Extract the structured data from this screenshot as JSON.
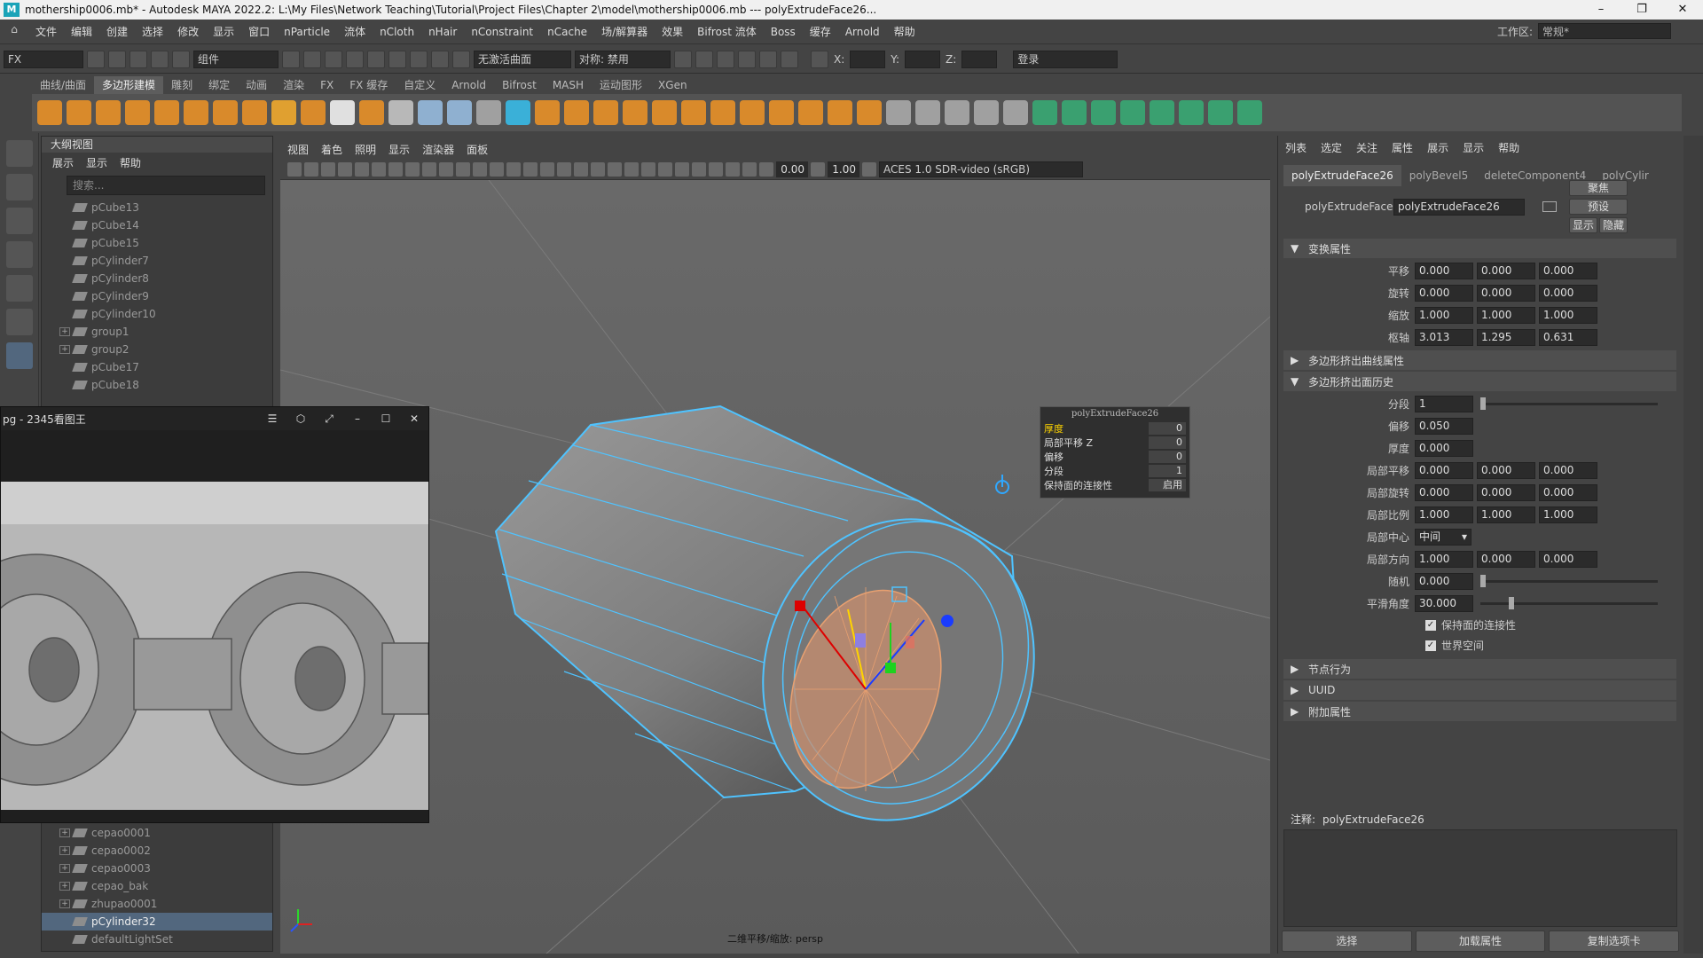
{
  "titlebar": {
    "title": "mothership0006.mb* - Autodesk MAYA 2022.2: L:\\My Files\\Network Teaching\\Tutorial\\Project Files\\Chapter 2\\model\\mothership0006.mb   ---   polyExtrudeFace26...",
    "minimize": "–",
    "restore": "❐",
    "close": "✕"
  },
  "menubar": {
    "items": [
      "文件",
      "编辑",
      "创建",
      "选择",
      "修改",
      "显示",
      "窗口",
      "nParticle",
      "流体",
      "nCloth",
      "nHair",
      "nConstraint",
      "nCache",
      "场/解算器",
      "效果",
      "Bifrost 流体",
      "Boss",
      "缓存",
      "Arnold",
      "帮助"
    ],
    "workspace_label": "工作区:",
    "workspace_value": "常规*"
  },
  "statusline": {
    "mode": "FX",
    "component_field": "组件",
    "live_surface": "无激活曲面",
    "symmetry": "对称: 禁用",
    "x_label": "X:",
    "y_label": "Y:",
    "z_label": "Z:",
    "login": "登录"
  },
  "shelf": {
    "tabs": [
      "曲线/曲面",
      "多边形建模",
      "雕刻",
      "绑定",
      "动画",
      "渲染",
      "FX",
      "FX 缓存",
      "自定义",
      "Arnold",
      "Bifrost",
      "MASH",
      "运动图形",
      "XGen"
    ],
    "active_tab": "多边形建模",
    "icon_colors": [
      "#d98a2b",
      "#d98a2b",
      "#d98a2b",
      "#d98a2b",
      "#d98a2b",
      "#d98a2b",
      "#d98a2b",
      "#d98a2b",
      "#e0a030",
      "#d98a2b",
      "#e0e0e0",
      "#d98a2b",
      "#b8b8b8",
      "#8fb0d0",
      "#8fb0d0",
      "#a0a0a0",
      "#3ab0d8",
      "#d98a2b",
      "#d98a2b",
      "#d98a2b",
      "#d98a2b",
      "#d98a2b",
      "#d98a2b",
      "#d98a2b",
      "#d98a2b",
      "#d98a2b",
      "#d98a2b",
      "#d98a2b",
      "#d98a2b",
      "#a0a0a0",
      "#a0a0a0",
      "#a0a0a0",
      "#a0a0a0",
      "#a0a0a0",
      "#3aa070",
      "#3aa070",
      "#3aa070",
      "#3aa070",
      "#3aa070",
      "#3aa070",
      "#3aa070",
      "#3aa070"
    ]
  },
  "outliner": {
    "title": "大纲视图",
    "menus": [
      "展示",
      "显示",
      "帮助"
    ],
    "search_placeholder": "搜索...",
    "items_top": [
      {
        "label": "pCube13",
        "expandable": false,
        "selected": false
      },
      {
        "label": "pCube14",
        "expandable": false,
        "selected": false
      },
      {
        "label": "pCube15",
        "expandable": false,
        "selected": false
      },
      {
        "label": "pCylinder7",
        "expandable": false,
        "selected": false
      },
      {
        "label": "pCylinder8",
        "expandable": false,
        "selected": false
      },
      {
        "label": "pCylinder9",
        "expandable": false,
        "selected": false
      },
      {
        "label": "pCylinder10",
        "expandable": false,
        "selected": false
      },
      {
        "label": "group1",
        "expandable": true,
        "selected": false
      },
      {
        "label": "group2",
        "expandable": true,
        "selected": false
      },
      {
        "label": "pCube17",
        "expandable": false,
        "selected": false
      },
      {
        "label": "pCube18",
        "expandable": false,
        "selected": false
      }
    ],
    "items_bottom": [
      {
        "label": "cepao0001",
        "expandable": true,
        "selected": false
      },
      {
        "label": "cepao0002",
        "expandable": true,
        "selected": false
      },
      {
        "label": "cepao0003",
        "expandable": true,
        "selected": false
      },
      {
        "label": "cepao_bak",
        "expandable": true,
        "selected": false
      },
      {
        "label": "zhupao0001",
        "expandable": true,
        "selected": false
      },
      {
        "label": "pCylinder32",
        "expandable": false,
        "selected": true
      },
      {
        "label": "defaultLightSet",
        "expandable": false,
        "selected": false
      }
    ]
  },
  "image_viewer": {
    "title": "pg - 2345看图王",
    "menu_icon": "☰",
    "skin_icon": "⬡",
    "fullscreen_icon": "⤢",
    "minimize": "–",
    "maximize": "☐",
    "close": "✕"
  },
  "viewport": {
    "menus": [
      "视图",
      "着色",
      "照明",
      "显示",
      "渲染器",
      "面板"
    ],
    "exposure": "0.00",
    "gamma": "1.00",
    "colorspace": "ACES 1.0 SDR-video (sRGB)",
    "camera_label": "二维平移/缩放: persp"
  },
  "popup": {
    "title": "polyExtrudeFace26",
    "rows": [
      {
        "label": "厚度",
        "value": "0",
        "highlight": true
      },
      {
        "label": "局部平移 Z",
        "value": "0",
        "highlight": false
      },
      {
        "label": "偏移",
        "value": "0",
        "highlight": false
      },
      {
        "label": "分段",
        "value": "1",
        "highlight": false
      },
      {
        "label": "保持面的连接性",
        "value": "启用",
        "highlight": false
      }
    ]
  },
  "attribute_editor": {
    "menus": [
      "列表",
      "选定",
      "关注",
      "属性",
      "展示",
      "显示",
      "帮助"
    ],
    "tabs": [
      "polyExtrudeFace26",
      "polyBevel5",
      "deleteComponent4",
      "polyCylir"
    ],
    "active_tab": "polyExtrudeFace26",
    "node_label": "polyExtrudeFace:",
    "node_name": "polyExtrudeFace26",
    "focus_button": "聚焦",
    "presets_button": "预设",
    "show_button": "显示",
    "hide_button": "隐藏",
    "sections": {
      "transform": "变换属性",
      "curve": "多边形挤出曲线属性",
      "history": "多边形挤出面历史",
      "node_behavior": "节点行为",
      "uuid": "UUID",
      "extra": "附加属性"
    },
    "transform_rows": [
      {
        "label": "平移",
        "values": [
          "0.000",
          "0.000",
          "0.000"
        ]
      },
      {
        "label": "旋转",
        "values": [
          "0.000",
          "0.000",
          "0.000"
        ]
      },
      {
        "label": "缩放",
        "values": [
          "1.000",
          "1.000",
          "1.000"
        ]
      },
      {
        "label": "枢轴",
        "values": [
          "3.013",
          "1.295",
          "0.631"
        ]
      }
    ],
    "history": {
      "divisions_label": "分段",
      "divisions_value": "1",
      "offset_label": "偏移",
      "offset_value": "0.050",
      "thickness_label": "厚度",
      "thickness_value": "0.000",
      "local_rows": [
        {
          "label": "局部平移",
          "values": [
            "0.000",
            "0.000",
            "0.000"
          ]
        },
        {
          "label": "局部旋转",
          "values": [
            "0.000",
            "0.000",
            "0.000"
          ]
        },
        {
          "label": "局部比例",
          "values": [
            "1.000",
            "1.000",
            "1.000"
          ]
        }
      ],
      "local_center_label": "局部中心",
      "local_center_value": "中间",
      "local_direction_label": "局部方向",
      "local_direction_values": [
        "1.000",
        "0.000",
        "0.000"
      ],
      "random_label": "随机",
      "random_value": "0.000",
      "smoothing_label": "平滑角度",
      "smoothing_value": "30.000",
      "keep_faces_label": "保持面的连接性",
      "world_space_label": "世界空间"
    },
    "notes_label": "注释:",
    "notes_value": "polyExtrudeFace26",
    "buttons": [
      "选择",
      "加载属性",
      "复制选项卡"
    ]
  }
}
